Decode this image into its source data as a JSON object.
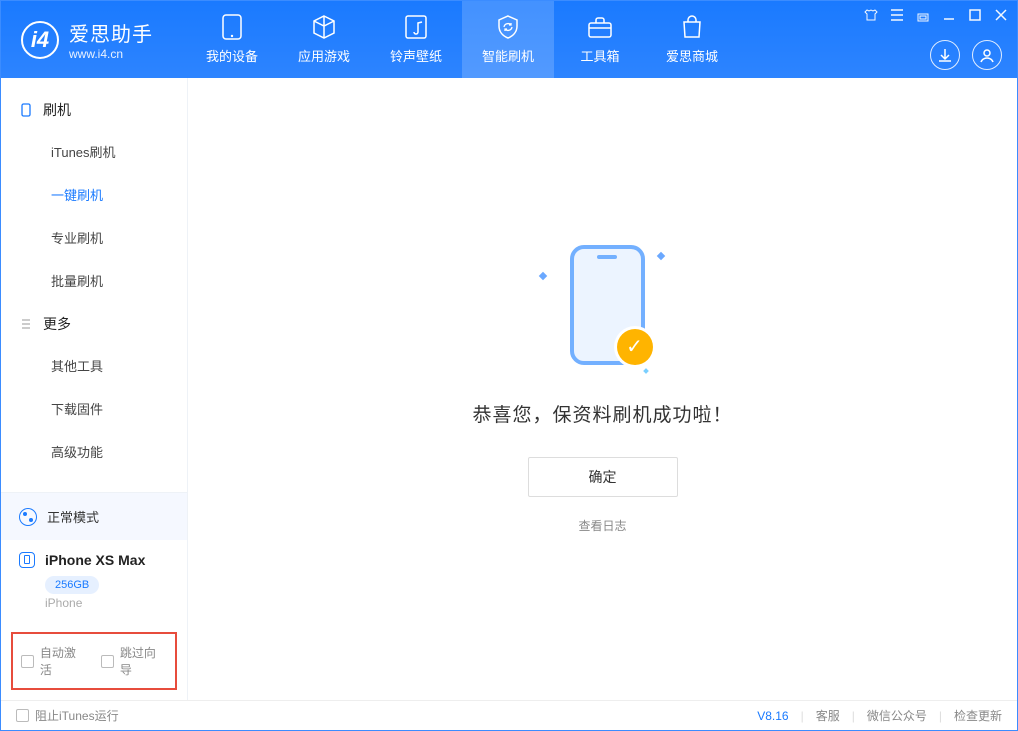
{
  "app": {
    "name": "爱思助手",
    "domain": "www.i4.cn"
  },
  "nav": {
    "items": [
      {
        "label": "我的设备"
      },
      {
        "label": "应用游戏"
      },
      {
        "label": "铃声壁纸"
      },
      {
        "label": "智能刷机"
      },
      {
        "label": "工具箱"
      },
      {
        "label": "爱思商城"
      }
    ]
  },
  "sidebar": {
    "section1": {
      "title": "刷机",
      "items": [
        "iTunes刷机",
        "一键刷机",
        "专业刷机",
        "批量刷机"
      ],
      "active_index": 1
    },
    "section2": {
      "title": "更多",
      "items": [
        "其他工具",
        "下载固件",
        "高级功能"
      ]
    },
    "mode": {
      "label": "正常模式"
    },
    "device": {
      "name": "iPhone XS Max",
      "storage": "256GB",
      "type": "iPhone"
    },
    "checks": {
      "auto_activate": "自动激活",
      "skip_guide": "跳过向导"
    }
  },
  "main": {
    "success_text": "恭喜您，保资料刷机成功啦！",
    "confirm_label": "确定",
    "view_log_label": "查看日志"
  },
  "statusbar": {
    "block_itunes": "阻止iTunes运行",
    "version": "V8.16",
    "links": [
      "客服",
      "微信公众号",
      "检查更新"
    ]
  },
  "colors": {
    "primary": "#1a7aff",
    "highlight": "#e74c3c",
    "accent": "#ffb400"
  }
}
